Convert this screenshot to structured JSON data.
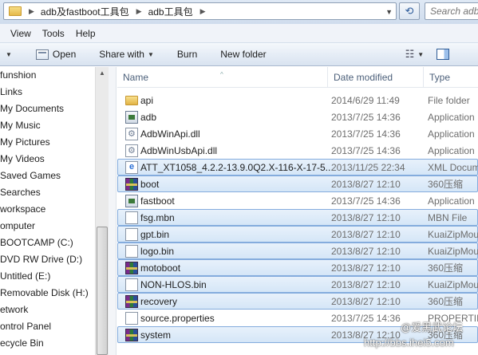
{
  "address": {
    "crumbs": [
      "adb及fastboot工具包",
      "adb工具包"
    ],
    "search_placeholder": "Search adb工具包"
  },
  "menubar": [
    "View",
    "Tools",
    "Help"
  ],
  "toolbar": {
    "open_label": "Open",
    "share_label": "Share with",
    "burn_label": "Burn",
    "new_folder_label": "New folder"
  },
  "nav": [
    "funshion",
    "Links",
    "My Documents",
    "My Music",
    "My Pictures",
    "My Videos",
    "Saved Games",
    "Searches",
    "workspace",
    "omputer",
    "BOOTCAMP (C:)",
    "DVD RW Drive (D:)",
    "Untitled (E:)",
    "Removable Disk (H:)",
    "etwork",
    "ontrol Panel",
    "ecycle Bin"
  ],
  "columns": {
    "name": "Name",
    "date": "Date modified",
    "type": "Type"
  },
  "files": [
    {
      "name": "api",
      "date": "2014/6/29 11:49",
      "type": "File folder",
      "icon": "folder-icon",
      "selected": false
    },
    {
      "name": "adb",
      "date": "2013/7/25 14:36",
      "type": "Application",
      "icon": "application-icon",
      "selected": false
    },
    {
      "name": "AdbWinApi.dll",
      "date": "2013/7/25 14:36",
      "type": "Application",
      "icon": "dll-icon",
      "selected": false
    },
    {
      "name": "AdbWinUsbApi.dll",
      "date": "2013/7/25 14:36",
      "type": "Application",
      "icon": "dll-icon",
      "selected": false
    },
    {
      "name": "ATT_XT1058_4.2.2-13.9.0Q2.X-116-X-17-5...",
      "date": "2013/11/25 22:34",
      "type": "XML Docum",
      "icon": "xml-icon",
      "selected": true
    },
    {
      "name": "boot",
      "date": "2013/8/27 12:10",
      "type": "360压缩",
      "icon": "archive-icon",
      "selected": true
    },
    {
      "name": "fastboot",
      "date": "2013/7/25 14:36",
      "type": "Application",
      "icon": "application-icon",
      "selected": false
    },
    {
      "name": "fsg.mbn",
      "date": "2013/8/27 12:10",
      "type": "MBN File",
      "icon": "file-icon",
      "selected": true
    },
    {
      "name": "gpt.bin",
      "date": "2013/8/27 12:10",
      "type": "KuaiZipMou",
      "icon": "file-icon",
      "selected": true
    },
    {
      "name": "logo.bin",
      "date": "2013/8/27 12:10",
      "type": "KuaiZipMou",
      "icon": "file-icon",
      "selected": true
    },
    {
      "name": "motoboot",
      "date": "2013/8/27 12:10",
      "type": "360压缩",
      "icon": "archive-icon",
      "selected": true
    },
    {
      "name": "NON-HLOS.bin",
      "date": "2013/8/27 12:10",
      "type": "KuaiZipMou",
      "icon": "file-icon",
      "selected": true
    },
    {
      "name": "recovery",
      "date": "2013/8/27 12:10",
      "type": "360压缩",
      "icon": "archive-icon",
      "selected": true
    },
    {
      "name": "source.properties",
      "date": "2013/7/25 14:36",
      "type": "PROPERTIES",
      "icon": "file-icon",
      "selected": false
    },
    {
      "name": "system",
      "date": "2013/8/27 12:10",
      "type": "360压缩",
      "icon": "archive-icon",
      "selected": true
    }
  ],
  "watermark": {
    "line1": "@爱黑武论坛",
    "line2": "http://bbs.ihei5.com"
  }
}
